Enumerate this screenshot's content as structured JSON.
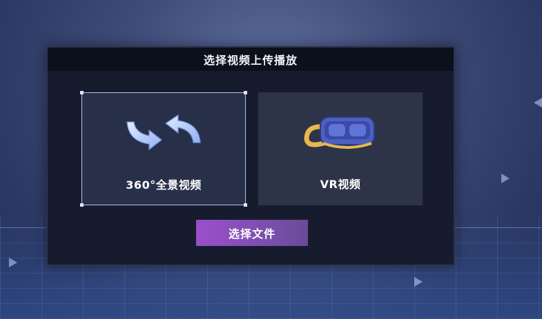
{
  "dialog": {
    "title": "选择视频上传播放"
  },
  "options": [
    {
      "label": "360°全景视频",
      "icon": "rotate-360-icon",
      "selected": true
    },
    {
      "label": "VR视频",
      "icon": "vr-headset-icon",
      "selected": false
    }
  ],
  "select_button": {
    "label": "选择文件"
  },
  "colors": {
    "background": "#3e4b78",
    "dialog": "#161c2e",
    "header": "#0c101c",
    "card": "#2d3447",
    "button_start": "#9a4fcc",
    "button_end": "#6a4a98"
  }
}
